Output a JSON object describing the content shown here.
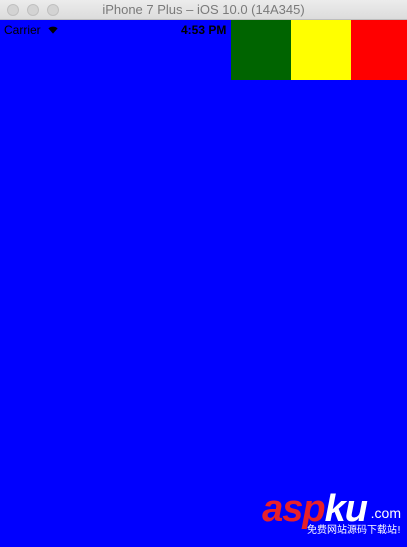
{
  "window": {
    "title": "iPhone 7 Plus – iOS 10.0 (14A345)"
  },
  "status_bar": {
    "carrier": "Carrier",
    "time": "4:53 PM",
    "wifi_icon": "wifi-icon",
    "battery_icon": "battery-icon"
  },
  "screen": {
    "background": "#0000ff",
    "blocks": [
      {
        "name": "green",
        "color": "#006400"
      },
      {
        "name": "yellow",
        "color": "#ffff00"
      },
      {
        "name": "red",
        "color": "#ff0000"
      }
    ]
  },
  "watermark": {
    "brand_part1": "asp",
    "brand_part2": "ku",
    "domain": ".com",
    "subtitle": "免费网站源码下载站!"
  }
}
